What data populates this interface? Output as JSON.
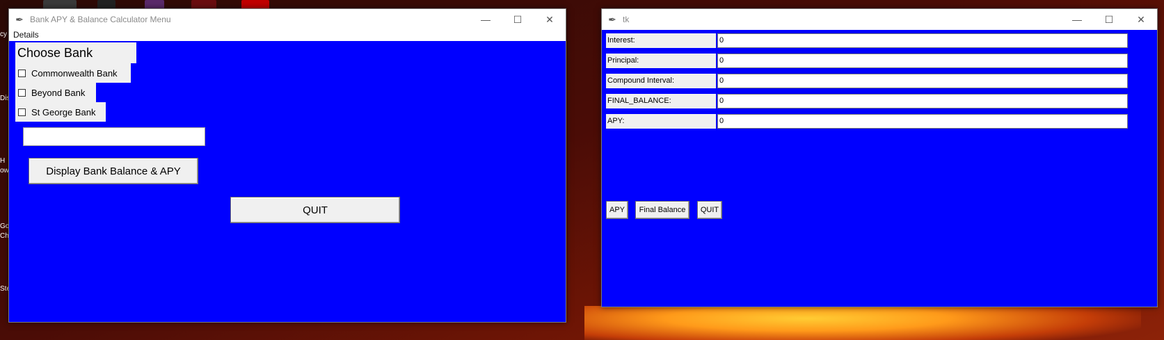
{
  "desktop": {
    "left_icon_labels": [
      "cy",
      "Dis",
      "H",
      "ow",
      "Go",
      "Chr",
      "Ste"
    ]
  },
  "window_menu": {
    "title": "Bank APY & Balance Calculator Menu",
    "menu": [
      "Details"
    ],
    "heading": "Choose Bank Options",
    "checkboxes": [
      {
        "label": "Commonwealth Bank",
        "checked": false
      },
      {
        "label": "Beyond Bank",
        "checked": false
      },
      {
        "label": "St George Bank",
        "checked": false
      }
    ],
    "entry_value": "",
    "display_button": "Display Bank Balance & APY",
    "quit_button": "QUIT"
  },
  "window_tk": {
    "title": "tk",
    "fields": [
      {
        "label": "Interest:",
        "value": "0"
      },
      {
        "label": "Principal:",
        "value": "0"
      },
      {
        "label": "Compound Interval:",
        "value": "0"
      },
      {
        "label": "FINAL_BALANCE:",
        "value": "0"
      },
      {
        "label": "APY:",
        "value": "0"
      }
    ],
    "buttons": {
      "apy": "APY",
      "final_balance": "Final Balance",
      "quit": "QUIT"
    }
  },
  "colors": {
    "window_background": "#0000ff",
    "widget_background": "#f0f0f0"
  }
}
